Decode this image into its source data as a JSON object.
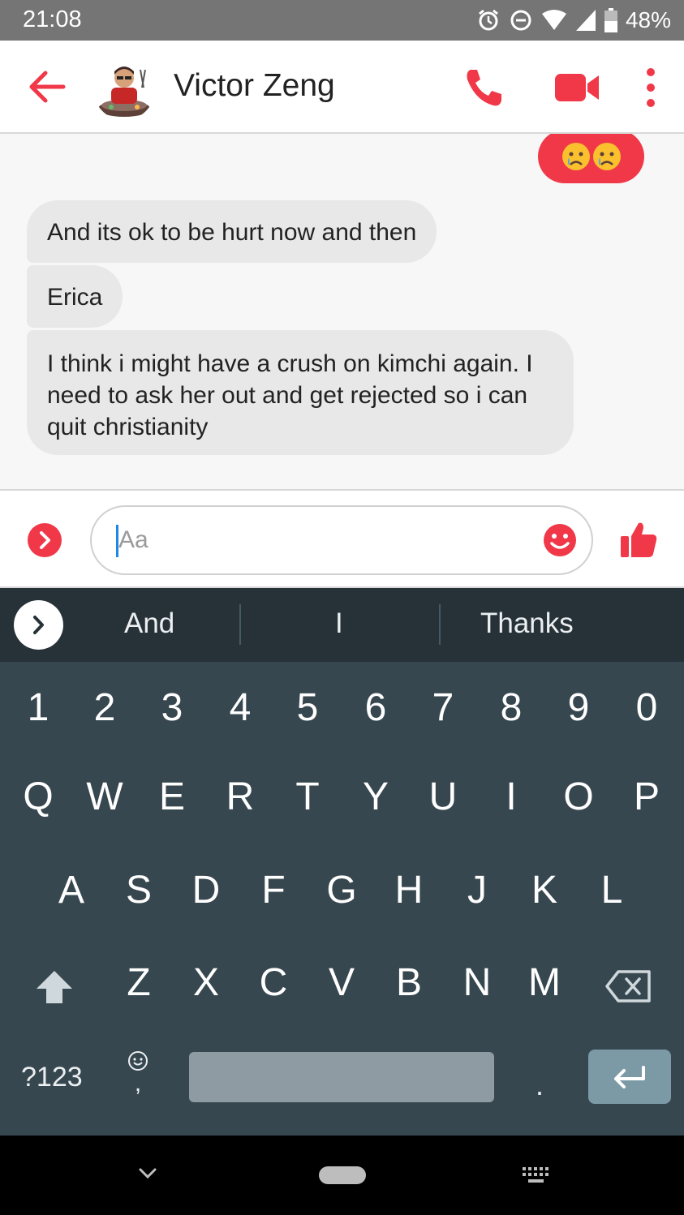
{
  "status_bar": {
    "time": "21:08",
    "battery": "48%"
  },
  "header": {
    "contact_name": "Victor Zeng"
  },
  "messages": {
    "sent": [
      {
        "type": "emoji",
        "content": "crying-face crying-face"
      }
    ],
    "received": [
      {
        "text": "And its ok to be hurt now and then"
      },
      {
        "text": "Erica"
      },
      {
        "text": "I think i might have a crush on kimchi again. I need to ask her out and get rejected so i can quit christianity"
      }
    ]
  },
  "composer": {
    "placeholder": "Aa"
  },
  "keyboard": {
    "suggestions": [
      "And",
      "I",
      "Thanks"
    ],
    "row_numbers": [
      "1",
      "2",
      "3",
      "4",
      "5",
      "6",
      "7",
      "8",
      "9",
      "0"
    ],
    "row_q": [
      "Q",
      "W",
      "E",
      "R",
      "T",
      "Y",
      "U",
      "I",
      "O",
      "P"
    ],
    "row_a": [
      "A",
      "S",
      "D",
      "F",
      "G",
      "H",
      "J",
      "K",
      "L"
    ],
    "row_z": [
      "Z",
      "X",
      "C",
      "V",
      "B",
      "N",
      "M"
    ],
    "symbols_label": "?123",
    "comma_label": ",",
    "period_label": "."
  },
  "colors": {
    "accent": "#f03848",
    "status_bar": "#757575",
    "keyboard_bg": "#37474f",
    "suggestion_bg": "#263238",
    "bubble_bg": "#e8e8e8"
  }
}
